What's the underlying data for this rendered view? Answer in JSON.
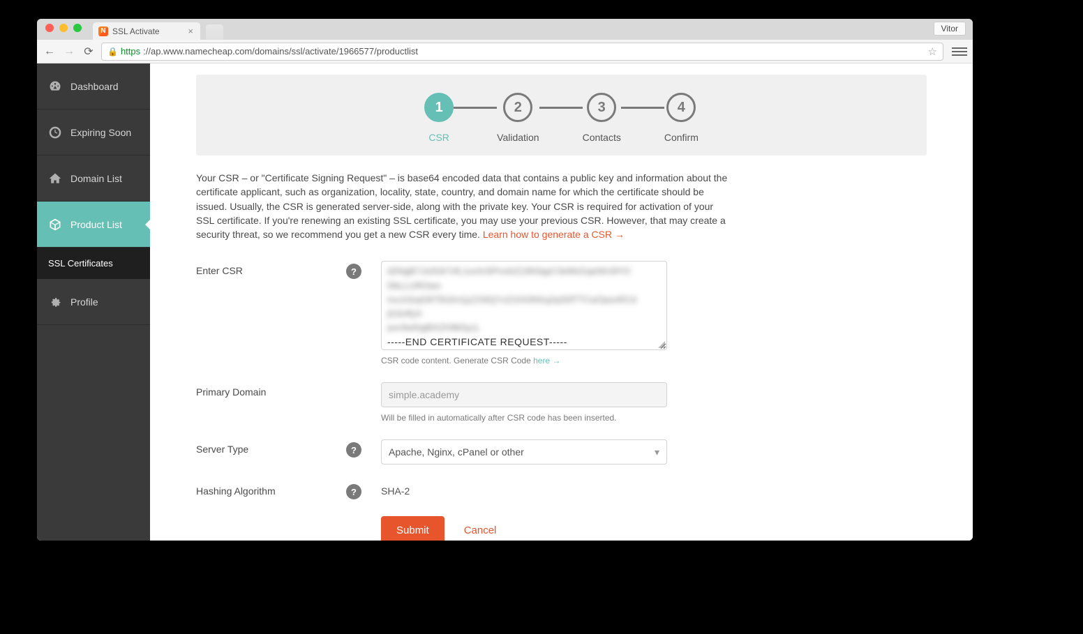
{
  "browser": {
    "tab_title": "SSL Activate",
    "user_badge": "Vitor",
    "url_https": "https",
    "url_rest": "://ap.www.namecheap.com/domains/ssl/activate/1966577/productlist"
  },
  "sidebar": {
    "items": [
      {
        "label": "Dashboard"
      },
      {
        "label": "Expiring Soon"
      },
      {
        "label": "Domain List"
      },
      {
        "label": "Product List"
      },
      {
        "label": "Profile"
      }
    ],
    "sub_label": "SSL Certificates"
  },
  "stepper": {
    "steps": [
      {
        "num": "1",
        "label": "CSR"
      },
      {
        "num": "2",
        "label": "Validation"
      },
      {
        "num": "3",
        "label": "Contacts"
      },
      {
        "num": "4",
        "label": "Confirm"
      }
    ]
  },
  "description": {
    "text": "Your CSR – or \"Certificate Signing Request\" – is base64 encoded data that contains a public key and information about the certificate applicant, such as organization, locality, state, country, and domain name for which the certificate should be issued. Usually, the CSR is generated server-side, along with the private key. Your CSR is required for activation of your SSL certificate. If you're renewing an existing SSL certificate, you may use your previous CSR. However, that may create a security threat, so we recommend you get a new CSR every time. ",
    "link": "Learn how to generate a CSR →"
  },
  "form": {
    "csr_label": "Enter CSR",
    "csr_hint_pre": "CSR code content. Generate CSR Code ",
    "csr_hint_link": "here →",
    "csr_blur": "d2NgB7Jx0Gk7vfL1xchrSPrnshZ19h0qpC3eMsGqeWn3lYO\nDbLLUROwo\nmxJcfzqG875h2m1jzZX9QYxZi1hGlhKq2q3SfTTCwOpsxRCd\nj01k4fyX\npvc9wIhg8tXZH9k5ycL",
    "csr_end": "-----END CERTIFICATE REQUEST-----",
    "primary_label": "Primary Domain",
    "primary_value": "simple.academy",
    "primary_hint": "Will be filled in automatically after CSR code has been inserted.",
    "server_label": "Server Type",
    "server_value": "Apache, Nginx, cPanel or other",
    "hash_label": "Hashing Algorithm",
    "hash_value": "SHA-2",
    "submit": "Submit",
    "cancel": "Cancel"
  }
}
